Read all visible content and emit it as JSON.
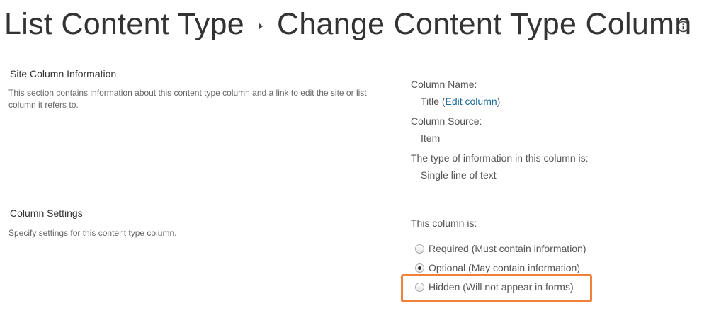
{
  "header": {
    "crumb_parent": "List Content Type",
    "crumb_current": "Change Content Type Column"
  },
  "site_column_info": {
    "title": "Site Column Information",
    "description": "This section contains information about this content type column and a link to edit the site or list column it refers to.",
    "column_name_label": "Column Name:",
    "column_name_value": "Title",
    "edit_link_text": "Edit column",
    "column_source_label": "Column Source:",
    "column_source_value": "Item",
    "type_label": "The type of information in this column is:",
    "type_value": "Single line of text"
  },
  "column_settings": {
    "title": "Column Settings",
    "description": "Specify settings for this content type column.",
    "status_label": "This column is:",
    "options": [
      {
        "label": "Required (Must contain information)",
        "checked": false
      },
      {
        "label": "Optional (May contain information)",
        "checked": true
      },
      {
        "label": "Hidden (Will not appear in forms)",
        "checked": false
      }
    ]
  },
  "colors": {
    "highlight": "#f0813a",
    "link": "#1a6a9a"
  },
  "icons": {
    "info": "info-icon",
    "breadcrumb_separator": "caret-right-icon"
  }
}
